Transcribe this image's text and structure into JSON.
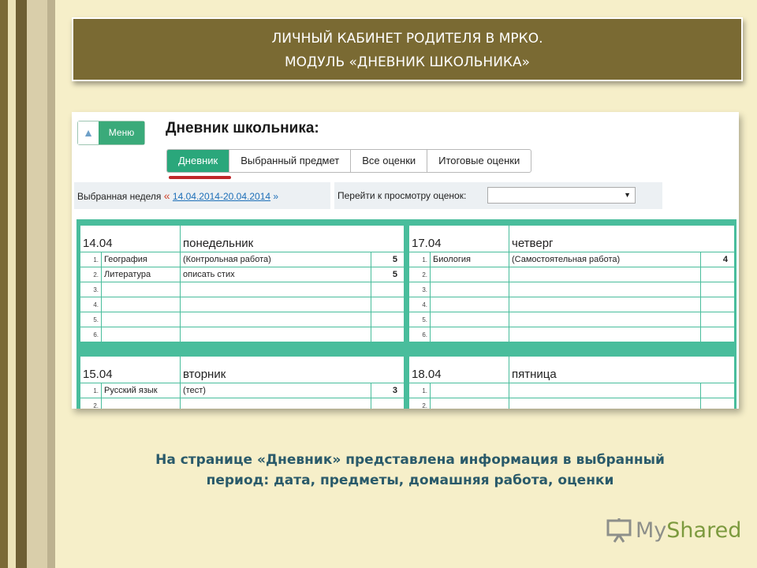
{
  "slide": {
    "title_line1": "ЛИЧНЫЙ КАБИНЕТ РОДИТЕЛЯ  В МРКО.",
    "title_line2": "МОДУЛЬ «ДНЕВНИК ШКОЛЬНИКА»",
    "caption_line1": "На  странице «Дневник» представлена информация в выбранный",
    "caption_line2": "период: дата, предметы, домашняя работа, оценки"
  },
  "app": {
    "menu_label": "Меню",
    "page_title": "Дневник школьника:",
    "tabs": [
      "Дневник",
      "Выбранный предмет",
      "Все оценки",
      "Итоговые оценки"
    ],
    "active_tab": "Дневник",
    "week_label": "Выбранная неделя",
    "week_prev": "«",
    "week_value": "14.04.2014-20.04.2014",
    "week_next": "»",
    "view_label": "Перейти к просмотру оценок:",
    "view_value": "",
    "view_arrow": "▼"
  },
  "days": [
    {
      "date": "14.04",
      "weekday": "понедельник",
      "lessons": [
        {
          "n": "1.",
          "subject": "География",
          "homework": "(Контрольная работа)",
          "grade": "5"
        },
        {
          "n": "2.",
          "subject": "Литература",
          "homework": "описать стих",
          "grade": "5"
        },
        {
          "n": "3.",
          "subject": "",
          "homework": "",
          "grade": ""
        },
        {
          "n": "4.",
          "subject": "",
          "homework": "",
          "grade": ""
        },
        {
          "n": "5.",
          "subject": "",
          "homework": "",
          "grade": ""
        },
        {
          "n": "6.",
          "subject": "",
          "homework": "",
          "grade": ""
        }
      ]
    },
    {
      "date": "17.04",
      "weekday": "четверг",
      "lessons": [
        {
          "n": "1.",
          "subject": "Биология",
          "homework": "(Самостоятельная работа)",
          "grade": "4"
        },
        {
          "n": "2.",
          "subject": "",
          "homework": "",
          "grade": ""
        },
        {
          "n": "3.",
          "subject": "",
          "homework": "",
          "grade": ""
        },
        {
          "n": "4.",
          "subject": "",
          "homework": "",
          "grade": ""
        },
        {
          "n": "5.",
          "subject": "",
          "homework": "",
          "grade": ""
        },
        {
          "n": "6.",
          "subject": "",
          "homework": "",
          "grade": ""
        }
      ]
    },
    {
      "date": "15.04",
      "weekday": "вторник",
      "lessons": [
        {
          "n": "1.",
          "subject": "Русский язык",
          "homework": "(тест)",
          "grade": "3"
        },
        {
          "n": "2.",
          "subject": "",
          "homework": "",
          "grade": ""
        }
      ]
    },
    {
      "date": "18.04",
      "weekday": "пятница",
      "lessons": [
        {
          "n": "1.",
          "subject": "",
          "homework": "",
          "grade": ""
        },
        {
          "n": "2.",
          "subject": "",
          "homework": "",
          "grade": ""
        }
      ]
    }
  ],
  "watermark": {
    "prefix": "My",
    "suffix": "Shared"
  },
  "colors": {
    "accent": "#2aa77b",
    "banner": "#7a6a33",
    "background": "#f6efc9",
    "link": "#1d6fb8"
  }
}
